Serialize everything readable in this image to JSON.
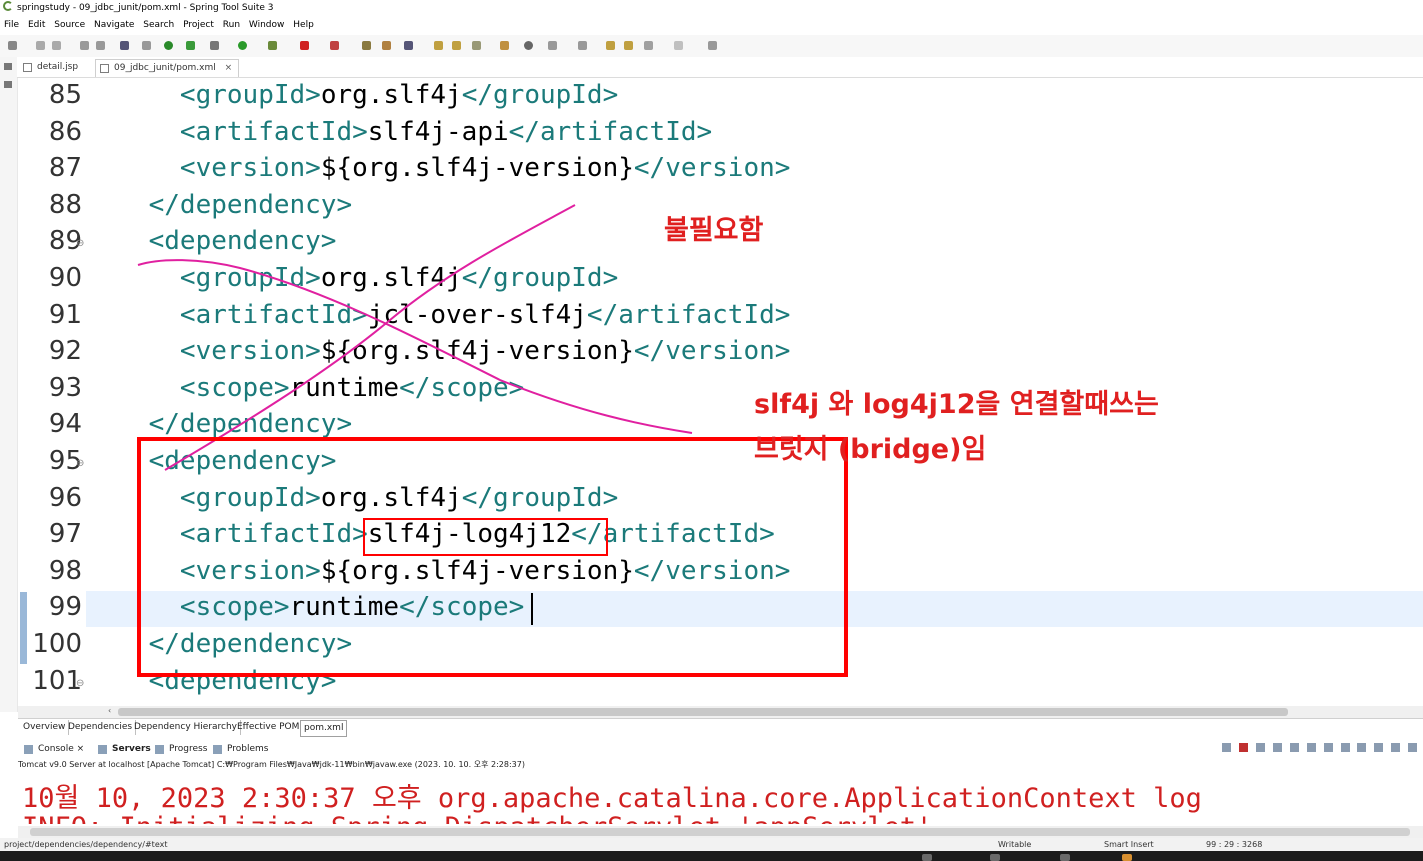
{
  "window": {
    "title": "springstudy - 09_jdbc_junit/pom.xml - Spring Tool Suite 3"
  },
  "menu": [
    "File",
    "Edit",
    "Source",
    "Navigate",
    "Search",
    "Project",
    "Run",
    "Window",
    "Help"
  ],
  "editor_tabs": [
    {
      "label": "detail.jsp",
      "active": false
    },
    {
      "label": "09_jdbc_junit/pom.xml",
      "active": true,
      "close": "×"
    }
  ],
  "editor": {
    "lines": [
      {
        "num": "85",
        "fold": "",
        "open": "<groupId>",
        "text": "org.slf4j",
        "close": "</groupId>"
      },
      {
        "num": "86",
        "fold": "",
        "open": "<artifactId>",
        "text": "slf4j-api",
        "close": "</artifactId>"
      },
      {
        "num": "87",
        "fold": "",
        "open": "<version>",
        "text": "${org.slf4j-version}",
        "close": "</version>"
      },
      {
        "num": "88",
        "fold": "",
        "open": "</dependency>",
        "text": "",
        "close": ""
      },
      {
        "num": "89",
        "fold": "⊖",
        "open": "<dependency>",
        "text": "",
        "close": ""
      },
      {
        "num": "90",
        "fold": "",
        "open": "<groupId>",
        "text": "org.slf4j",
        "close": "</groupId>"
      },
      {
        "num": "91",
        "fold": "",
        "open": "<artifactId>",
        "text": "jcl-over-slf4j",
        "close": "</artifactId>"
      },
      {
        "num": "92",
        "fold": "",
        "open": "<version>",
        "text": "${org.slf4j-version}",
        "close": "</version>"
      },
      {
        "num": "93",
        "fold": "",
        "open": "<scope>",
        "text": "runtime",
        "close": "</scope>"
      },
      {
        "num": "94",
        "fold": "",
        "open": "</dependency>",
        "text": "",
        "close": ""
      },
      {
        "num": "95",
        "fold": "⊖",
        "open": "<dependency>",
        "text": "",
        "close": ""
      },
      {
        "num": "96",
        "fold": "",
        "open": "<groupId>",
        "text": "org.slf4j",
        "close": "</groupId>"
      },
      {
        "num": "97",
        "fold": "",
        "open": "<artifactId>",
        "text": "slf4j-log4j12",
        "close": "</artifactId>"
      },
      {
        "num": "98",
        "fold": "",
        "open": "<version>",
        "text": "${org.slf4j-version}",
        "close": "</version>"
      },
      {
        "num": "99",
        "fold": "",
        "open": "<scope>",
        "text": "runtime",
        "close": "</scope>"
      },
      {
        "num": "100",
        "fold": "",
        "open": "</dependency>",
        "text": "",
        "close": ""
      },
      {
        "num": "101",
        "fold": "⊖",
        "open": "<dependency>",
        "text": "",
        "close": ""
      }
    ],
    "current_line": "99"
  },
  "annotations": {
    "unneeded": "불필요함",
    "bridge_line1": "slf4j 와 log4j12을 연결할때쓰는",
    "bridge_line2": "브릿지 (bridge)임",
    "color": "#e02020",
    "stroke_color": "#e020a0"
  },
  "pom_tabs": [
    "Overview",
    "Dependencies",
    "Dependency Hierarchy",
    "Effective POM",
    "pom.xml"
  ],
  "pom_active": "pom.xml",
  "console_tabs": [
    {
      "label": "Console",
      "close": "×"
    },
    {
      "label": "Servers"
    },
    {
      "label": "Progress"
    },
    {
      "label": "Problems"
    }
  ],
  "console": {
    "subtitle": "Tomcat v9.0 Server at localhost [Apache Tomcat] C:₩Program Files₩Java₩jdk-11₩bin₩javaw.exe  (2023. 10. 10. 오후 2:28:37)",
    "line1": "10월 10, 2023 2:30:37 오후 org.apache.catalina.core.ApplicationContext log",
    "line2": "INFO: Initializing Spring DispatcherServlet 'appServlet'"
  },
  "status": {
    "path": "project/dependencies/dependency/#text",
    "writable": "Writable",
    "insert_mode": "Smart Insert",
    "position": "99 : 29 : 3268"
  }
}
